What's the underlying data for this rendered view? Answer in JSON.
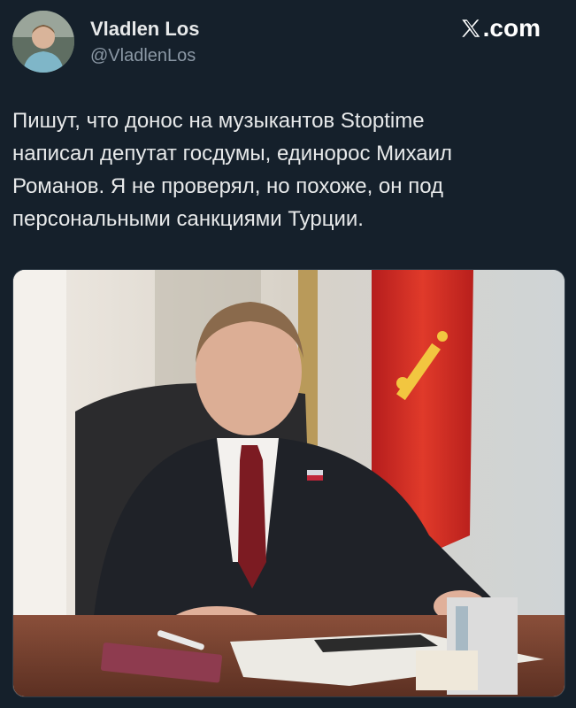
{
  "author": {
    "name": "Vladlen Los",
    "handle": "@VladlenLos",
    "avatar_icon": "profile-photo"
  },
  "brand": {
    "logo_icon": "x-logo-icon",
    "domain_suffix": ".com"
  },
  "tweet": {
    "lines": [
      "Пишут, что донос на музыкантов Stoptime",
      "написал депутат госдумы, единорос Михаил",
      "Романов. Я не проверял, но похоже, он под",
      "персональными санкциями Турции."
    ]
  },
  "media": {
    "kind": "photo",
    "subject": "man-in-suit-at-desk-with-flag"
  }
}
